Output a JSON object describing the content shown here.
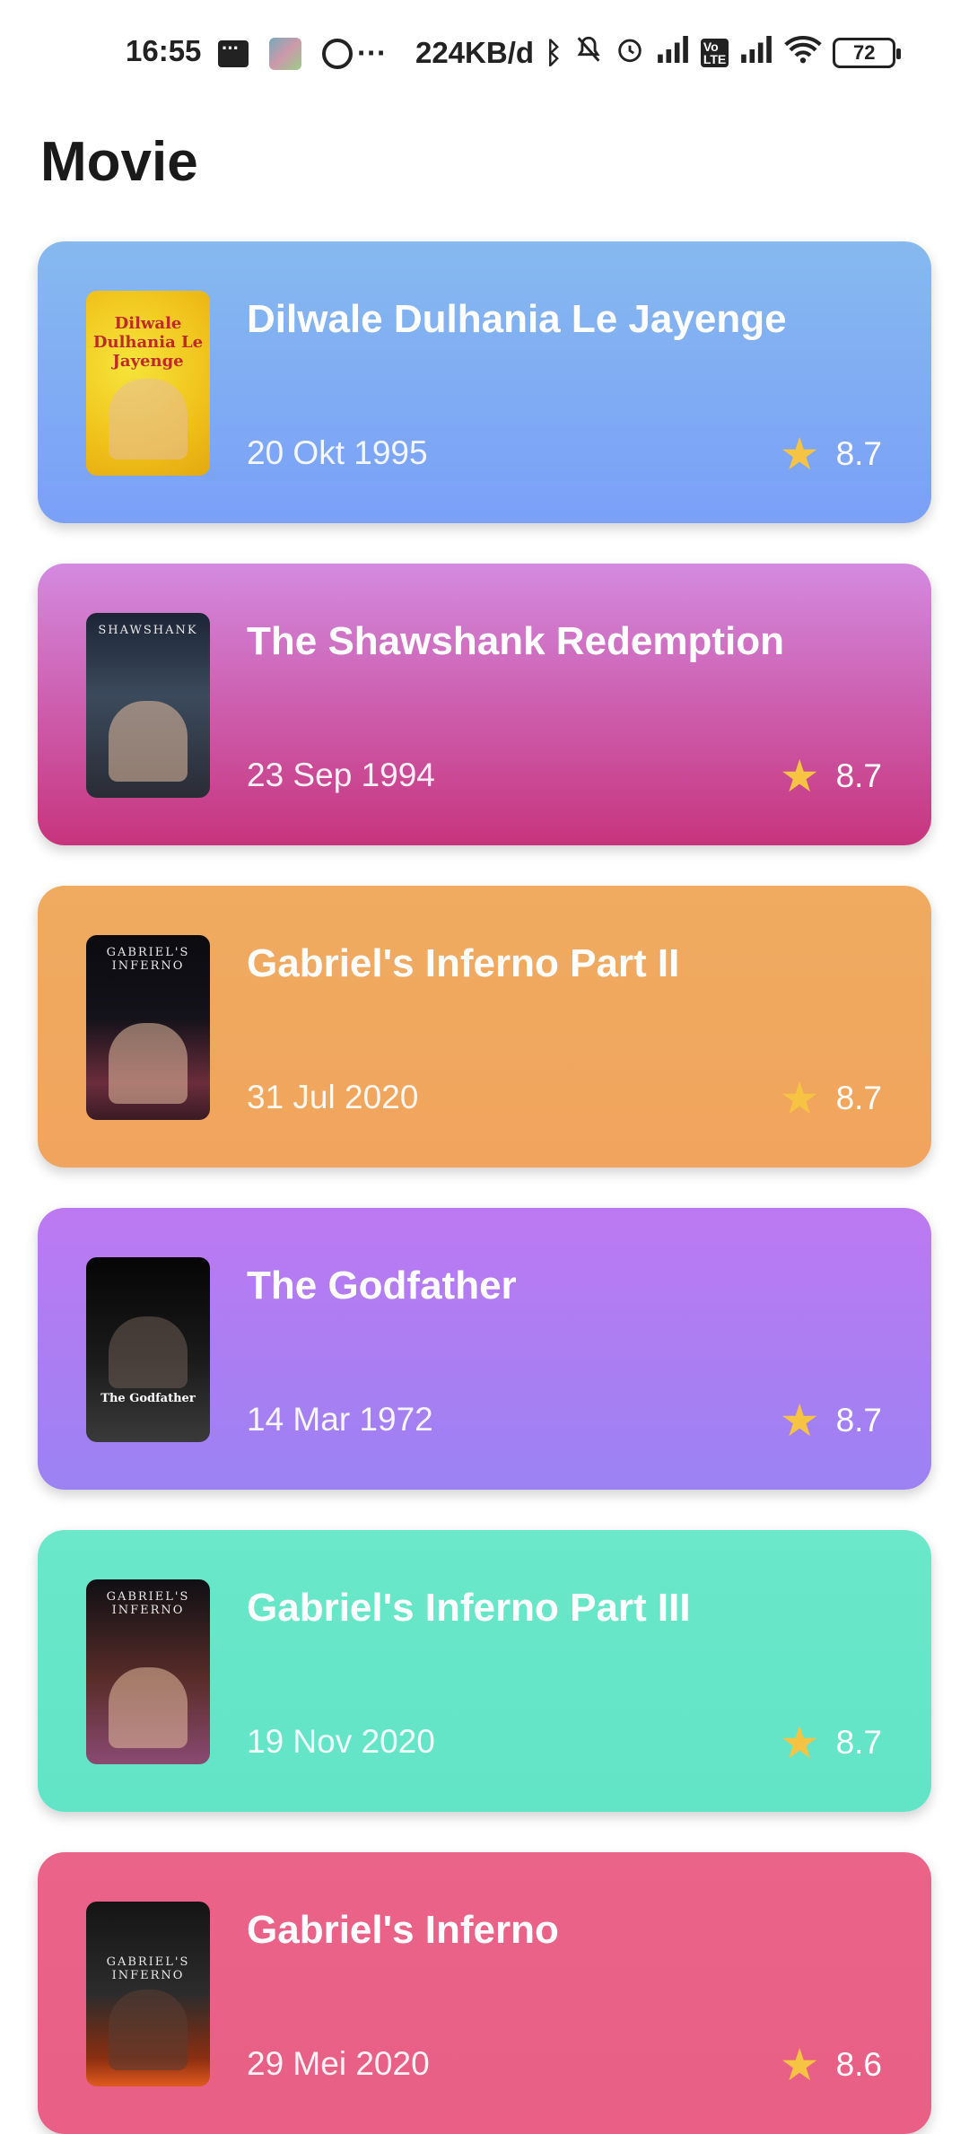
{
  "status_bar": {
    "time": "16:55",
    "network_speed": "224KB/d",
    "battery": "72",
    "icons": [
      "message-icon",
      "app-icon",
      "whatsapp-icon",
      "more-dots-icon",
      "bluetooth-icon",
      "mute-icon",
      "alarm-icon",
      "signal-icon",
      "volte-icon",
      "signal-icon",
      "wifi-icon",
      "battery-icon"
    ]
  },
  "page": {
    "title": "Movie"
  },
  "movies": [
    {
      "title": "Dilwale Dulhania Le Jayenge",
      "date": "20 Okt 1995",
      "rating": "8.7",
      "poster_label": "Dilwale Dulhania Le Jayenge",
      "color_top": "#86b9ef",
      "color_bottom": "#7aa0f8"
    },
    {
      "title": "The Shawshank Redemption",
      "date": "23 Sep 1994",
      "rating": "8.7",
      "poster_label": "SHAWSHANK",
      "color_top": "#d38ae0",
      "color_bottom": "#c7347d"
    },
    {
      "title": "Gabriel's Inferno Part II",
      "date": "31 Jul 2020",
      "rating": "8.7",
      "poster_label": "GABRIEL'S INFERNO",
      "color_top": "#f0ab60",
      "color_bottom": "#f1a45e"
    },
    {
      "title": "The Godfather",
      "date": "14 Mar 1972",
      "rating": "8.7",
      "poster_label": "The Godfather",
      "color_top": "#bd79f2",
      "color_bottom": "#9b82f3"
    },
    {
      "title": "Gabriel's Inferno Part III",
      "date": "19 Nov 2020",
      "rating": "8.7",
      "poster_label": "GABRIEL'S INFERNO",
      "color_top": "#6ae8c9",
      "color_bottom": "#62e4c7"
    },
    {
      "title": "Gabriel's Inferno",
      "date": "29 Mei 2020",
      "rating": "8.6",
      "poster_label": "GABRIEL'S INFERNO",
      "color_top": "#ea6389",
      "color_bottom": "#e95f85"
    }
  ],
  "colors": {
    "star": "#f6c343",
    "title_text": "#1a1a1a"
  }
}
